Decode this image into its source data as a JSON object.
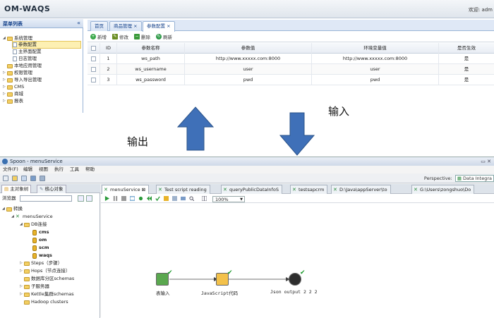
{
  "top": {
    "app_title": "OM-WAQS",
    "welcome": "欢迎: adm",
    "menu_title": "菜单列表",
    "tree": [
      {
        "label": "系统管理",
        "type": "folder",
        "arrow": "◢"
      },
      {
        "label": "参数配置",
        "type": "leaf",
        "selected": true
      },
      {
        "label": "主界面配置",
        "type": "leaf"
      },
      {
        "label": "日志管理",
        "type": "leaf"
      },
      {
        "label": "本地应用管理",
        "type": "folder"
      },
      {
        "label": "权限管理",
        "type": "folder",
        "arrow": "▷"
      },
      {
        "label": "导入导出管理",
        "type": "folder",
        "arrow": "▷"
      },
      {
        "label": "CMS",
        "type": "folder",
        "arrow": "▷"
      },
      {
        "label": "商城",
        "type": "folder",
        "arrow": "▷"
      },
      {
        "label": "报表",
        "type": "folder",
        "arrow": "▷"
      }
    ],
    "tabs": [
      {
        "label": "首页"
      },
      {
        "label": "商品管理 ×"
      },
      {
        "label": "参数配置 ×",
        "active": true
      }
    ],
    "toolbar": {
      "add": "新增",
      "edit": "修改",
      "delete": "删除",
      "refresh": "刷新"
    },
    "grid": {
      "headers": [
        "",
        "ID",
        "参数名称",
        "参数值",
        "环境变量值",
        "是否生效"
      ],
      "rows": [
        [
          "",
          "1",
          "ws_path",
          "http://www.xxxxx.com:8000",
          "http://www.xxxxx.com:8000",
          "是"
        ],
        [
          "",
          "2",
          "ws_username",
          "user",
          "user",
          "是"
        ],
        [
          "",
          "3",
          "ws_password",
          "pwd",
          "pwd",
          "是"
        ]
      ]
    }
  },
  "labels": {
    "output": "输出",
    "input": "输入"
  },
  "spoon": {
    "title": "Spoon - menuService",
    "menu": [
      "文件(F)",
      "编辑",
      "视图",
      "执行",
      "工具",
      "帮助"
    ],
    "perspective_label": "Perspective:",
    "perspective_value": "Data Integra",
    "left_tabs": [
      "主对象树",
      "核心对象"
    ],
    "browser_label": "浏览器",
    "tree": [
      {
        "label": "转换",
        "kind": "folder"
      },
      {
        "label": "menuService",
        "kind": "trans"
      },
      {
        "label": "DB连接",
        "kind": "folder"
      },
      {
        "label": "cms",
        "kind": "db"
      },
      {
        "label": "om",
        "kind": "db"
      },
      {
        "label": "scm",
        "kind": "db"
      },
      {
        "label": "waqs",
        "kind": "db"
      },
      {
        "label": "Steps（步骤）",
        "kind": "folder"
      },
      {
        "label": "Hops（节点连接）",
        "kind": "folder"
      },
      {
        "label": "数据库分区schemas",
        "kind": "folder"
      },
      {
        "label": "子服务器",
        "kind": "folder"
      },
      {
        "label": "Kettle集群schemas",
        "kind": "folder"
      },
      {
        "label": "Hadoop clusters",
        "kind": "folder"
      }
    ],
    "editor_tabs": [
      {
        "label": "menuService ⊠",
        "active": true
      },
      {
        "label": "Test script reading"
      },
      {
        "label": "queryPublicDataInfoS"
      },
      {
        "label": "testsapcrm"
      },
      {
        "label": "D:\\Java\\appServer\\to"
      },
      {
        "label": "G:\\Users\\zongshuo\\Do"
      }
    ],
    "zoom": "100%",
    "steps": [
      {
        "label": "表输入",
        "color": "#4a9a48"
      },
      {
        "label": "JavaScript代码",
        "color": "#e8a820"
      },
      {
        "label": "Json output 2 2 2",
        "color": "#3a3a3a"
      }
    ]
  },
  "colors": {
    "arrow": "#3f70b8",
    "arrow_edge": "#2b5389",
    "link": "#15428b"
  }
}
